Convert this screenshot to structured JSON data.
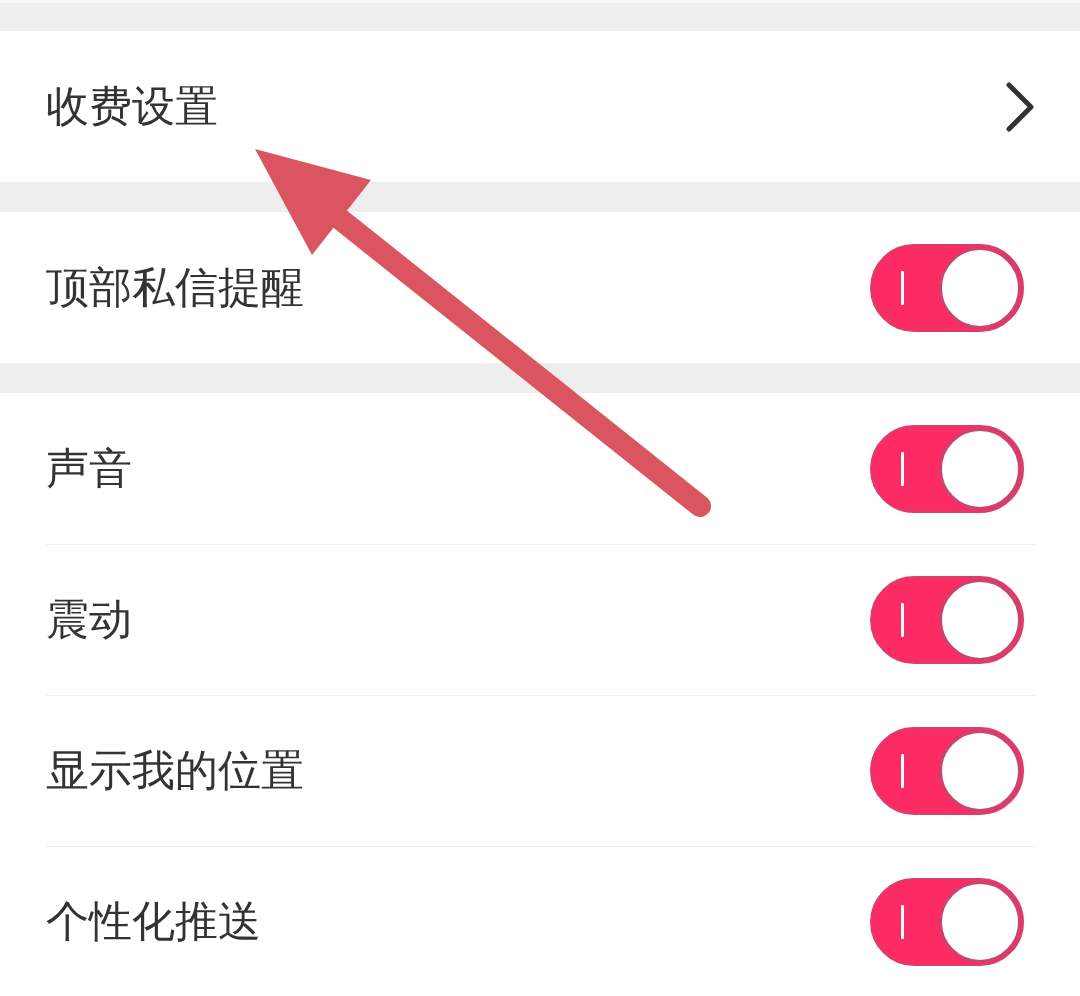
{
  "sections": [
    {
      "items": [
        {
          "kind": "link",
          "label": "收费设置"
        }
      ]
    },
    {
      "items": [
        {
          "kind": "toggle",
          "label": "顶部私信提醒",
          "on": true
        }
      ]
    },
    {
      "items": [
        {
          "kind": "toggle",
          "label": "声音",
          "on": true
        },
        {
          "kind": "toggle",
          "label": "震动",
          "on": true
        },
        {
          "kind": "toggle",
          "label": "显示我的位置",
          "on": true
        },
        {
          "kind": "toggle",
          "label": "个性化推送",
          "on": true
        }
      ]
    }
  ]
}
